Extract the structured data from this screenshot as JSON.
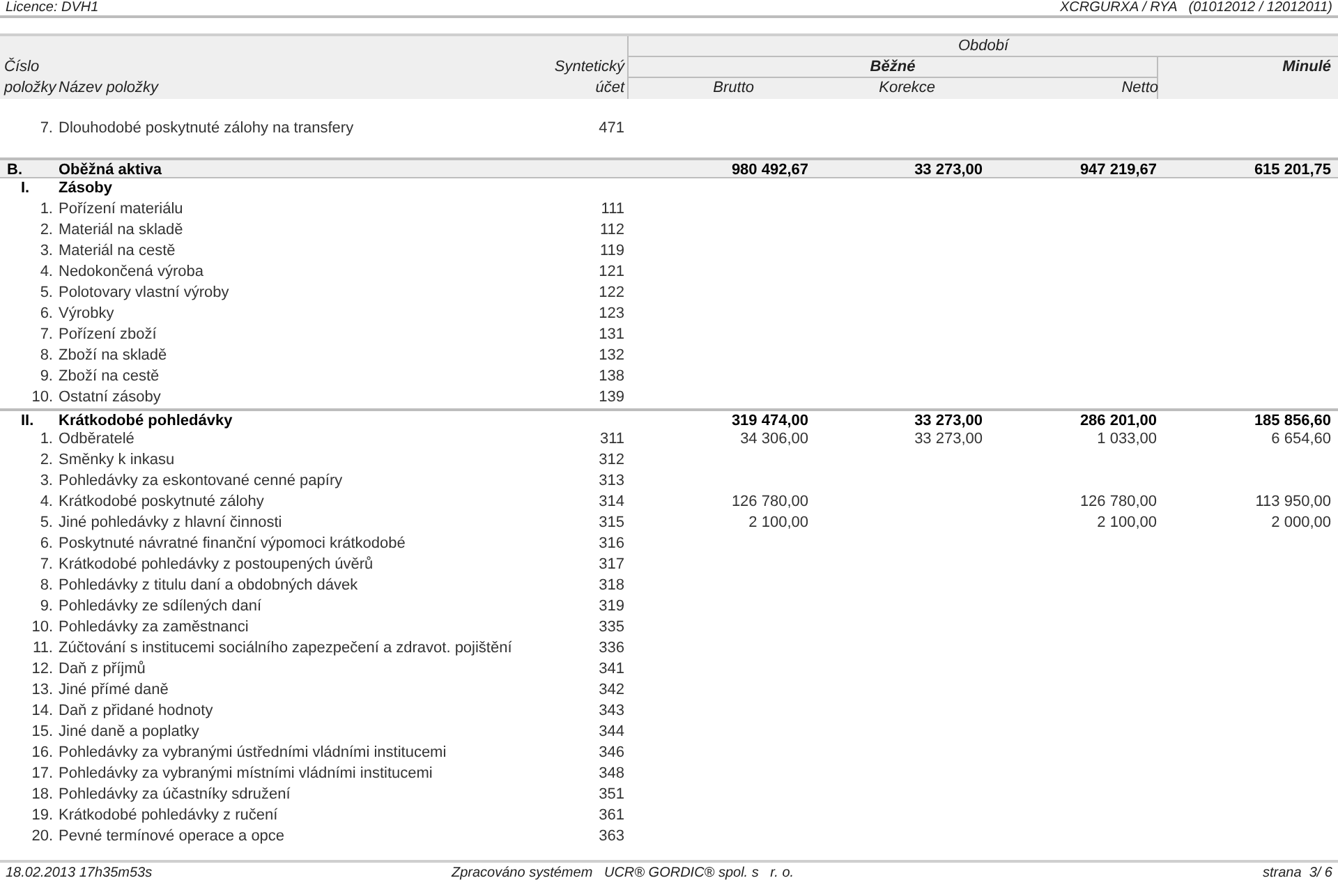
{
  "top_bar": {
    "licence": "Licence: DVH1",
    "report_code": "XCRGURXA / RYA   (01012012 / 12012011)"
  },
  "table": {
    "headers": {
      "period": "Období",
      "number_line1": "Číslo",
      "number_line2": "položky",
      "name": "Název položky",
      "account_line1": "Syntetický",
      "account_line2": "účet",
      "current": "Běžné",
      "previous": "Minulé",
      "brutto": "Brutto",
      "korekce": "Korekce",
      "netto": "Netto"
    },
    "rows": [
      {
        "kind": "item",
        "number": "7.",
        "name": "Dlouhodobé poskytnuté zálohy na transfery",
        "account": "471"
      },
      {
        "kind": "section",
        "number": "B.",
        "name": "Oběžná aktiva",
        "brutto": "980 492,67",
        "korekce": "33 273,00",
        "netto": "947 219,67",
        "previous": "615 201,75"
      },
      {
        "kind": "group",
        "number": "I.",
        "name": "Zásoby"
      },
      {
        "kind": "item",
        "number": "1.",
        "name": "Pořízení materiálu",
        "account": "111"
      },
      {
        "kind": "item",
        "number": "2.",
        "name": "Materiál na skladě",
        "account": "112"
      },
      {
        "kind": "item",
        "number": "3.",
        "name": "Materiál na cestě",
        "account": "119"
      },
      {
        "kind": "item",
        "number": "4.",
        "name": "Nedokončená výroba",
        "account": "121"
      },
      {
        "kind": "item",
        "number": "5.",
        "name": "Polotovary vlastní výroby",
        "account": "122"
      },
      {
        "kind": "item",
        "number": "6.",
        "name": "Výrobky",
        "account": "123"
      },
      {
        "kind": "item",
        "number": "7.",
        "name": "Pořízení zboží",
        "account": "131"
      },
      {
        "kind": "item",
        "number": "8.",
        "name": "Zboží na skladě",
        "account": "132"
      },
      {
        "kind": "item",
        "number": "9.",
        "name": "Zboží na cestě",
        "account": "138"
      },
      {
        "kind": "item",
        "number": "10.",
        "name": "Ostatní zásoby",
        "account": "139"
      },
      {
        "kind": "group",
        "number": "II.",
        "name": "Krátkodobé pohledávky",
        "brutto": "319 474,00",
        "korekce": "33 273,00",
        "netto": "286 201,00",
        "previous": "185 856,60"
      },
      {
        "kind": "item",
        "number": "1.",
        "name": "Odběratelé",
        "account": "311",
        "brutto": "34 306,00",
        "korekce": "33 273,00",
        "netto": "1 033,00",
        "previous": "6 654,60"
      },
      {
        "kind": "item",
        "number": "2.",
        "name": "Směnky k inkasu",
        "account": "312"
      },
      {
        "kind": "item",
        "number": "3.",
        "name": "Pohledávky za eskontované cenné papíry",
        "account": "313"
      },
      {
        "kind": "item",
        "number": "4.",
        "name": "Krátkodobé poskytnuté zálohy",
        "account": "314",
        "brutto": "126 780,00",
        "netto": "126 780,00",
        "previous": "113 950,00"
      },
      {
        "kind": "item",
        "number": "5.",
        "name": "Jiné pohledávky z hlavní činnosti",
        "account": "315",
        "brutto": "2 100,00",
        "netto": "2 100,00",
        "previous": "2 000,00"
      },
      {
        "kind": "item",
        "number": "6.",
        "name": "Poskytnuté návratné finanční výpomoci krátkodobé",
        "account": "316"
      },
      {
        "kind": "item",
        "number": "7.",
        "name": "Krátkodobé pohledávky z postoupených úvěrů",
        "account": "317"
      },
      {
        "kind": "item",
        "number": "8.",
        "name": "Pohledávky z titulu daní a obdobných dávek",
        "account": "318"
      },
      {
        "kind": "item",
        "number": "9.",
        "name": "Pohledávky ze sdílených daní",
        "account": "319"
      },
      {
        "kind": "item",
        "number": "10.",
        "name": "Pohledávky za zaměstnanci",
        "account": "335"
      },
      {
        "kind": "item",
        "number": "11.",
        "name": "Zúčtování s institucemi sociálního zapezpečení a zdravot. pojištění",
        "account": "336"
      },
      {
        "kind": "item",
        "number": "12.",
        "name": "Daň z příjmů",
        "account": "341"
      },
      {
        "kind": "item",
        "number": "13.",
        "name": "Jiné přímé daně",
        "account": "342"
      },
      {
        "kind": "item",
        "number": "14.",
        "name": "Daň z přidané hodnoty",
        "account": "343"
      },
      {
        "kind": "item",
        "number": "15.",
        "name": "Jiné daně a poplatky",
        "account": "344"
      },
      {
        "kind": "item",
        "number": "16.",
        "name": "Pohledávky za vybranými ústředními vládními institucemi",
        "account": "346"
      },
      {
        "kind": "item",
        "number": "17.",
        "name": "Pohledávky za vybranými místními vládními institucemi",
        "account": "348"
      },
      {
        "kind": "item",
        "number": "18.",
        "name": "Pohledávky za účastníky sdružení",
        "account": "351"
      },
      {
        "kind": "item",
        "number": "19.",
        "name": "Krátkodobé pohledávky z ručení",
        "account": "361"
      },
      {
        "kind": "item",
        "number": "20.",
        "name": "Pevné termínové operace a opce",
        "account": "363"
      }
    ]
  },
  "footer": {
    "timestamp": "18.02.2013 17h35m53s",
    "processed_by": "Zpracováno systémem   UCR® GORDIC® spol. s   r. o.",
    "page": "strana  3/ 6"
  }
}
